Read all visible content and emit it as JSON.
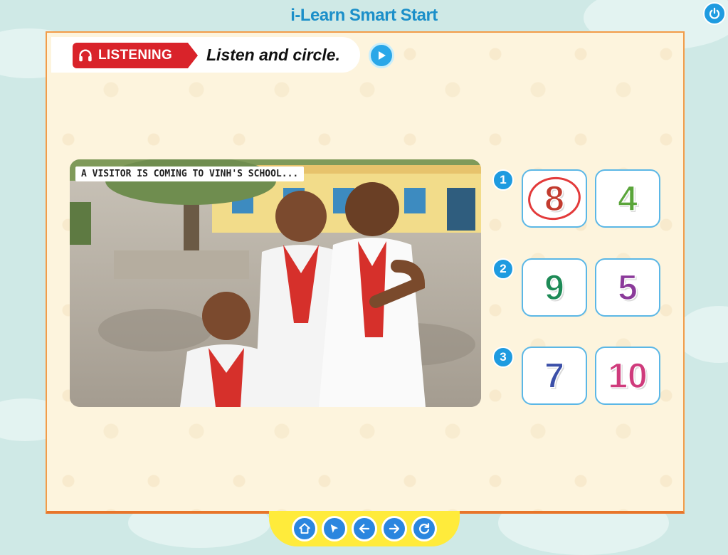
{
  "app": {
    "title": "i-Learn Smart Start"
  },
  "instruction": {
    "badge_label": "LISTENING",
    "text": "Listen and circle."
  },
  "photo": {
    "caption": "A VISITOR IS COMING TO VINH'S SCHOOL..."
  },
  "questions": [
    {
      "number": "1",
      "options": [
        {
          "value": "8",
          "color": "#c23b2e",
          "selected": true
        },
        {
          "value": "4",
          "color": "#5aa53a",
          "selected": false
        }
      ]
    },
    {
      "number": "2",
      "options": [
        {
          "value": "9",
          "color": "#1d8a56",
          "selected": false
        },
        {
          "value": "5",
          "color": "#8b3a9a",
          "selected": false
        }
      ]
    },
    {
      "number": "3",
      "options": [
        {
          "value": "7",
          "color": "#3b4fa8",
          "selected": false
        },
        {
          "value": "10",
          "color": "#cf3b7c",
          "selected": false
        }
      ]
    }
  ],
  "icons": {
    "power": "power-icon",
    "headphones": "headphones-icon",
    "play": "play-icon",
    "home": "home-icon",
    "pointer": "pointer-icon",
    "back": "arrow-left-icon",
    "forward": "arrow-right-icon",
    "reload": "refresh-icon"
  },
  "colors": {
    "accent": "#1e9be0",
    "badge": "#d9232a",
    "board": "#fdf4dd",
    "nav": "#ffeb3b"
  }
}
